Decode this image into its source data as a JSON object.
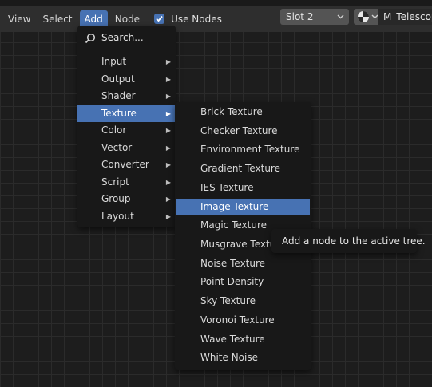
{
  "header": {
    "menus": [
      "View",
      "Select",
      "Add",
      "Node"
    ],
    "use_nodes_label": "Use Nodes",
    "use_nodes_checked": true,
    "slot_value": "Slot 2",
    "material_name": "M_Telescop"
  },
  "add_menu": {
    "search_label": "Search...",
    "items": [
      "Input",
      "Output",
      "Shader",
      "Texture",
      "Color",
      "Vector",
      "Converter",
      "Script",
      "Group",
      "Layout"
    ],
    "active_item": "Texture"
  },
  "texture_menu": {
    "items": [
      "Brick Texture",
      "Checker Texture",
      "Environment Texture",
      "Gradient Texture",
      "IES Texture",
      "Image Texture",
      "Magic Texture",
      "Musgrave Texture",
      "Noise Texture",
      "Point Density",
      "Sky Texture",
      "Voronoi Texture",
      "Wave Texture",
      "White Noise"
    ],
    "active_item": "Image Texture"
  },
  "tooltip": "Add a node to the active tree.",
  "colors": {
    "accent": "#4772b3",
    "menu_bg": "#181818",
    "canvas_bg": "#1d1d1d"
  }
}
